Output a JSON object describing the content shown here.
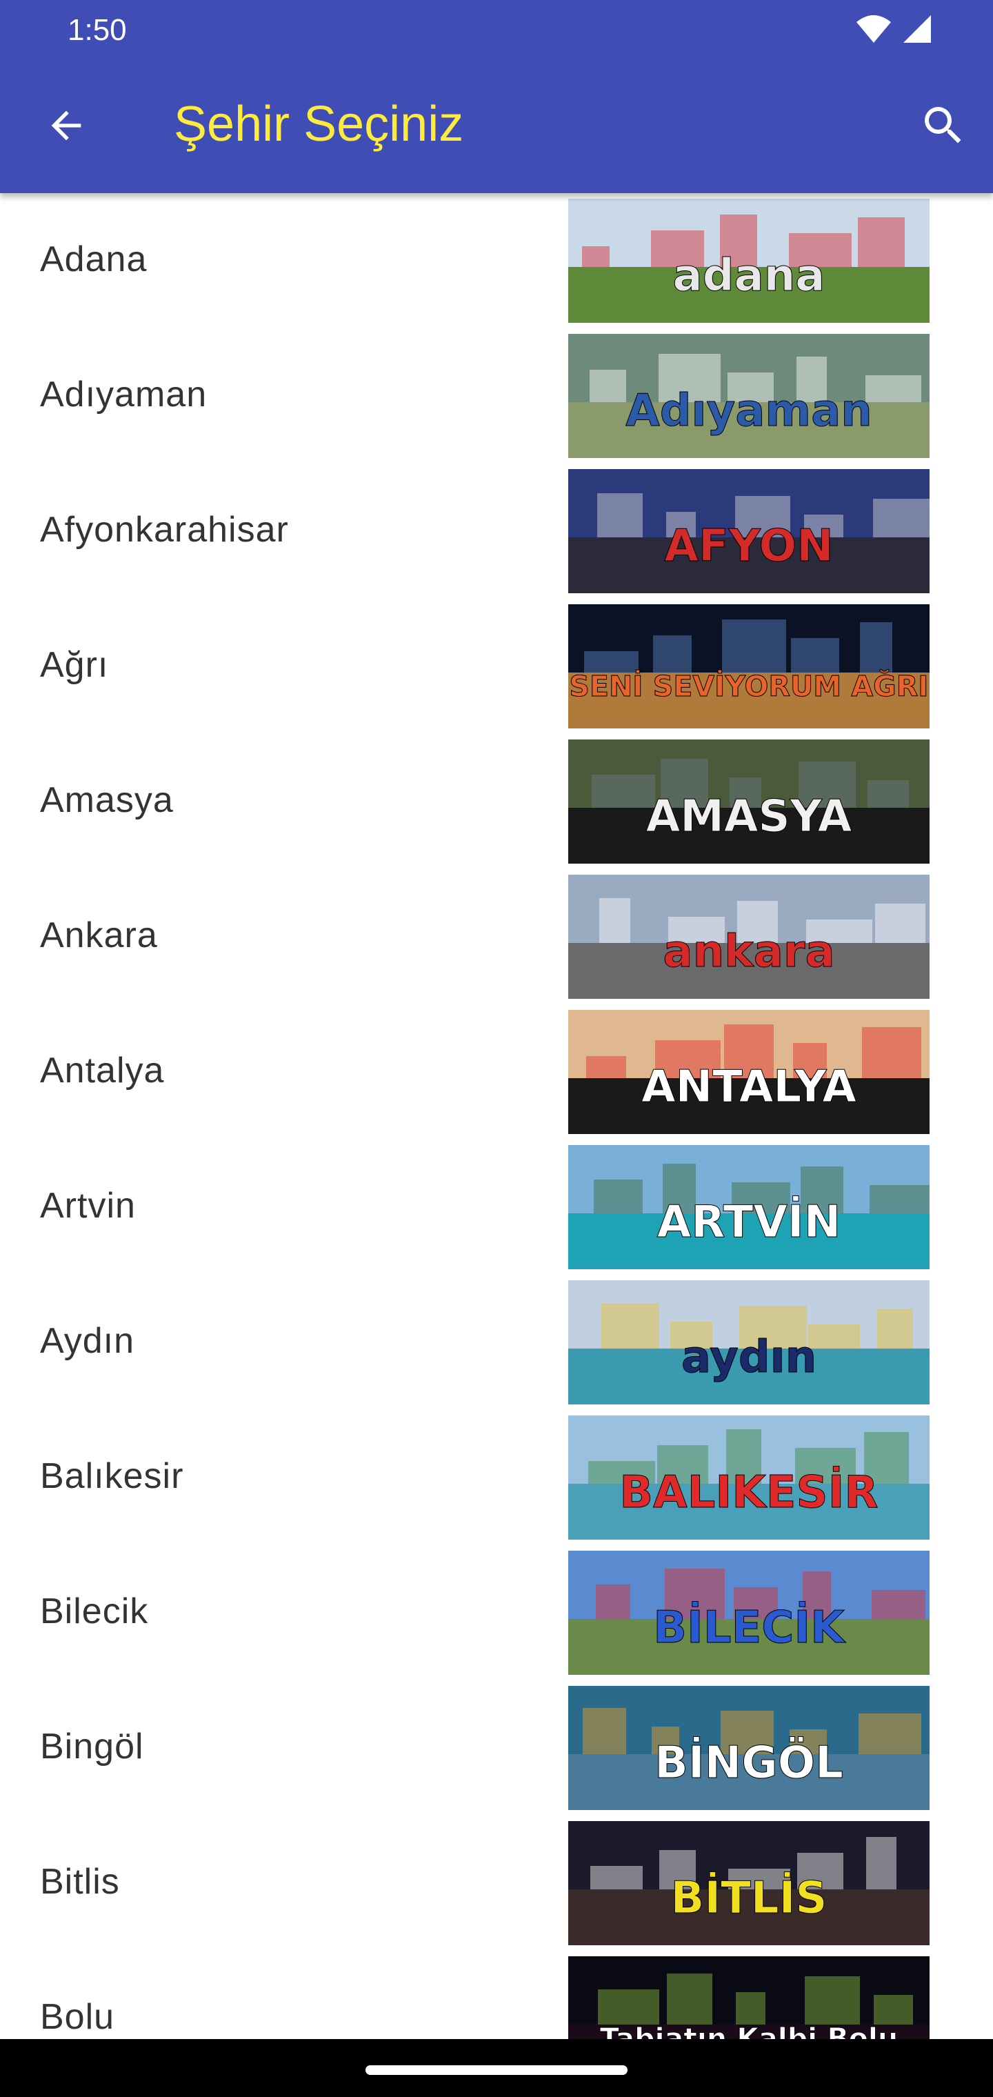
{
  "status_bar": {
    "time": "1:50",
    "icons": [
      "wifi-icon",
      "signal-icon"
    ]
  },
  "app_bar": {
    "title": "Şehir Seçiniz",
    "back_icon": "arrow-left-icon",
    "search_icon": "search-icon"
  },
  "cities": [
    {
      "name": "Adana",
      "photo_text": "adana",
      "colors": {
        "sky": "#c9d9e8",
        "ground": "#5e8a3a",
        "text": "#e8e8e8",
        "accent": "#d9262e"
      }
    },
    {
      "name": "Adıyaman",
      "photo_text": "Adıyaman",
      "colors": {
        "sky": "#6d8a7a",
        "ground": "#8a9a6a",
        "text": "#2a5aa8",
        "accent": "#ffffff"
      }
    },
    {
      "name": "Afyonkarahisar",
      "photo_text": "AFYON",
      "colors": {
        "sky": "#2a3a7a",
        "ground": "#2a2a3a",
        "text": "#d42a2a",
        "accent": "#dcdcdc"
      }
    },
    {
      "name": "Ağrı",
      "photo_text": "SENİ SEVİYORUM AĞRI",
      "colors": {
        "sky": "#0c1226",
        "ground": "#b07a3a",
        "text": "#e8642a",
        "accent": "#5a88c8"
      }
    },
    {
      "name": "Amasya",
      "photo_text": "AMASYA",
      "colors": {
        "sky": "#4a5a3a",
        "ground": "#1a1a1a",
        "text": "#f0f0f0",
        "accent": "#6a7a8a"
      }
    },
    {
      "name": "Ankara",
      "photo_text": "ankara",
      "colors": {
        "sky": "#9aaac0",
        "ground": "#6a6a6a",
        "text": "#d42a2a",
        "accent": "#ffffff"
      }
    },
    {
      "name": "Antalya",
      "photo_text": "ANTALYA",
      "colors": {
        "sky": "#e0b890",
        "ground": "#1a1a1a",
        "text": "#ffffff",
        "accent": "#e02a2a"
      }
    },
    {
      "name": "Artvin",
      "photo_text": "ARTVİN",
      "colors": {
        "sky": "#7ab0d8",
        "ground": "#1ea3b5",
        "text": "#ffffff",
        "accent": "#3a6a3a"
      }
    },
    {
      "name": "Aydın",
      "photo_text": "aydın",
      "colors": {
        "sky": "#c0d0e0",
        "ground": "#3a9ab0",
        "text": "#1a2a6a",
        "accent": "#e8c030"
      }
    },
    {
      "name": "Balıkesir",
      "photo_text": "BALIKESİR",
      "colors": {
        "sky": "#9ac0e0",
        "ground": "#4aa0b8",
        "text": "#e02a2a",
        "accent": "#3a8a3a"
      }
    },
    {
      "name": "Bilecik",
      "photo_text": "BİLECİK",
      "colors": {
        "sky": "#5a8ad0",
        "ground": "#6a8a4a",
        "text": "#2a5ad0",
        "accent": "#e02a2a"
      }
    },
    {
      "name": "Bingöl",
      "photo_text": "BİNGÖL",
      "colors": {
        "sky": "#2a6a8a",
        "ground": "#4a7a9a",
        "text": "#ffffff",
        "accent": "#f0a020"
      }
    },
    {
      "name": "Bitlis",
      "photo_text": "BİTLİS",
      "colors": {
        "sky": "#1a1a2a",
        "ground": "#3a2a2a",
        "text": "#f0e020",
        "accent": "#ffffff"
      }
    },
    {
      "name": "Bolu",
      "photo_text": "Tabiatın Kalbi Bolu",
      "colors": {
        "sky": "#0a0a14",
        "ground": "#1a0a1a",
        "text": "#ffffff",
        "accent": "#8ac040"
      }
    }
  ]
}
